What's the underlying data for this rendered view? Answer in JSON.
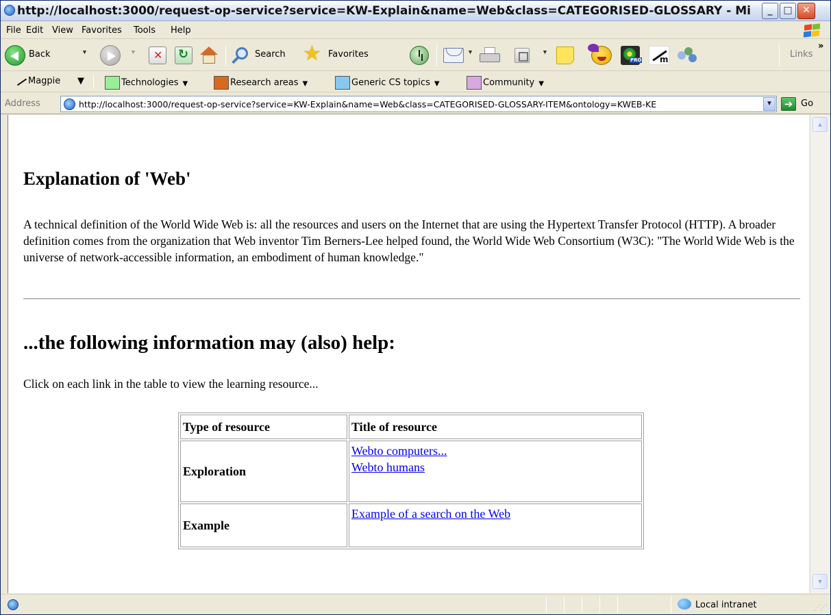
{
  "window": {
    "title": "http://localhost:3000/request-op-service?service=KW-Explain&name=Web&class=CATEGORISED-GLOSSARY - Mi...",
    "minimize_glyph": "_",
    "maximize_glyph": "□",
    "close_glyph": "✕"
  },
  "menu": {
    "items": [
      "File",
      "Edit",
      "View",
      "Favorites",
      "Tools",
      "Help"
    ]
  },
  "toolbar": {
    "back_label": "Back",
    "search_label": "Search",
    "favorites_label": "Favorites",
    "links_label": "Links",
    "more_glyph": "»"
  },
  "links_bar": {
    "items": [
      {
        "label": "Magpie",
        "color": ""
      },
      {
        "label": "Technologies",
        "color": "#99ee99"
      },
      {
        "label": "Research areas",
        "color": "#d86a1e"
      },
      {
        "label": "Generic CS topics",
        "color": "#88c8ee"
      },
      {
        "label": "Community",
        "color": "#d8a8e0"
      }
    ]
  },
  "address": {
    "label": "Address",
    "url": "http://localhost:3000/request-op-service?service=KW-Explain&name=Web&class=CATEGORISED-GLOSSARY-ITEM&ontology=KWEB-KE",
    "go_label": "Go"
  },
  "page": {
    "heading": "Explanation of 'Web'",
    "definition": "A technical definition of the World Wide Web is: all the resources and users on the Internet that are using the Hypertext Transfer Protocol (HTTP). A broader definition comes from the organization that Web inventor Tim Berners-Lee helped found, the World Wide Web Consortium (W3C): \"The World Wide Web is the universe of network-accessible information, an embodiment of human knowledge.\"",
    "subheading": "...the following information may (also) help:",
    "instructions": "Click on each link in the table to view the learning resource...",
    "table": {
      "headers": [
        "Type of resource",
        "Title of resource"
      ],
      "rows": [
        {
          "type": "Exploration",
          "links": [
            "Webto computers...",
            "Webto humans"
          ]
        },
        {
          "type": "Example",
          "links": [
            "Example of a search on the Web"
          ]
        }
      ]
    }
  },
  "status": {
    "zone": "Local intranet"
  }
}
